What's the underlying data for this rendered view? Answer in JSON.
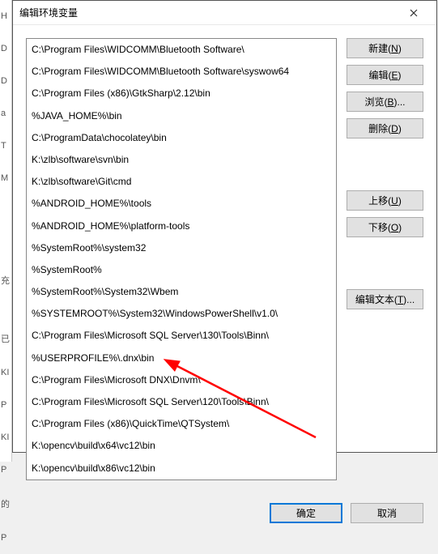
{
  "dialog": {
    "title": "编辑环境变量"
  },
  "paths": [
    "C:\\Program Files\\WIDCOMM\\Bluetooth Software\\",
    "C:\\Program Files\\WIDCOMM\\Bluetooth Software\\syswow64",
    "C:\\Program Files (x86)\\GtkSharp\\2.12\\bin",
    "%JAVA_HOME%\\bin",
    "C:\\ProgramData\\chocolatey\\bin",
    "K:\\zlb\\software\\svn\\bin",
    "K:\\zlb\\software\\Git\\cmd",
    "%ANDROID_HOME%\\tools",
    "%ANDROID_HOME%\\platform-tools",
    "%SystemRoot%\\system32",
    "%SystemRoot%",
    "%SystemRoot%\\System32\\Wbem",
    "%SYSTEMROOT%\\System32\\WindowsPowerShell\\v1.0\\",
    "C:\\Program Files\\Microsoft SQL Server\\130\\Tools\\Binn\\",
    "%USERPROFILE%\\.dnx\\bin",
    "C:\\Program Files\\Microsoft DNX\\Dnvm\\",
    "C:\\Program Files\\Microsoft SQL Server\\120\\Tools\\Binn\\",
    "C:\\Program Files (x86)\\QuickTime\\QTSystem\\",
    "K:\\opencv\\build\\x64\\vc12\\bin",
    "K:\\opencv\\build\\x86\\vc12\\bin"
  ],
  "buttons": {
    "new": "新建(N)",
    "edit": "编辑(E)",
    "browse": "浏览(B)...",
    "delete": "删除(D)",
    "moveup": "上移(U)",
    "movedown": "下移(O)",
    "edittext": "编辑文本(T)...",
    "ok": "确定",
    "cancel": "取消"
  },
  "backdrop_letters": [
    "H",
    "D",
    "D",
    "a",
    "T",
    "M",
    "",
    "",
    "",
    "充",
    "",
    "已",
    "KI",
    "P",
    "KI",
    "P",
    "的",
    "P"
  ]
}
